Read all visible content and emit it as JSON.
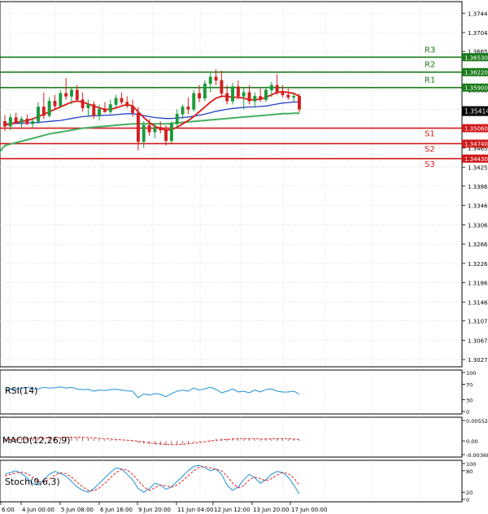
{
  "chart_data": {
    "type": "candlestick",
    "price_ticks": [
      "1.37440",
      "1.37040",
      "1.36650",
      "1.36250",
      "1.35850",
      "1.35450",
      "1.35060",
      "1.34650",
      "1.34250",
      "1.33860",
      "1.33460",
      "1.33060",
      "1.32660",
      "1.32260",
      "1.31860",
      "1.31460",
      "1.31070",
      "1.30670",
      "1.30270"
    ],
    "price_range": [
      1.3012,
      1.3768
    ],
    "levels": [
      {
        "name": "R3",
        "value": 1.3653,
        "tag": "1.36530",
        "color": "#1a7a1a"
      },
      {
        "name": "R2",
        "value": 1.3622,
        "tag": "1.36220",
        "color": "#1a7a1a"
      },
      {
        "name": "R1",
        "value": 1.359,
        "tag": "1.35900",
        "color": "#1a7a1a"
      },
      {
        "name": "S1",
        "value": 1.3506,
        "tag": "1.35060",
        "color": "#d11a1a"
      },
      {
        "name": "S2",
        "value": 1.3474,
        "tag": "1.34740",
        "color": "#d11a1a"
      },
      {
        "name": "S3",
        "value": 1.3443,
        "tag": "1.34430",
        "color": "#d11a1a"
      }
    ],
    "current_price": "1.35414",
    "current_price_value": 1.35414,
    "x_ticks": [
      "6:00",
      "4 Jun 00:00",
      "5 Jun 08:00",
      "6 Jun 16:00",
      "9 Jun 20:00",
      "11 Jun 04:00",
      "12 Jun 12:00",
      "13 Jun 20:00",
      "17 Jun 00:00"
    ],
    "candles": [
      {
        "o": 1.352,
        "h": 1.3533,
        "l": 1.35,
        "c": 1.351
      },
      {
        "o": 1.351,
        "h": 1.3535,
        "l": 1.3502,
        "c": 1.3528
      },
      {
        "o": 1.3528,
        "h": 1.3538,
        "l": 1.3515,
        "c": 1.3518
      },
      {
        "o": 1.3518,
        "h": 1.353,
        "l": 1.3508,
        "c": 1.3525
      },
      {
        "o": 1.3525,
        "h": 1.3534,
        "l": 1.3512,
        "c": 1.3515
      },
      {
        "o": 1.3515,
        "h": 1.3528,
        "l": 1.3507,
        "c": 1.352
      },
      {
        "o": 1.352,
        "h": 1.356,
        "l": 1.3515,
        "c": 1.355
      },
      {
        "o": 1.355,
        "h": 1.358,
        "l": 1.3525,
        "c": 1.3532
      },
      {
        "o": 1.3532,
        "h": 1.357,
        "l": 1.3528,
        "c": 1.3562
      },
      {
        "o": 1.3562,
        "h": 1.3575,
        "l": 1.3545,
        "c": 1.3552
      },
      {
        "o": 1.3552,
        "h": 1.3585,
        "l": 1.3548,
        "c": 1.3578
      },
      {
        "o": 1.3578,
        "h": 1.361,
        "l": 1.3565,
        "c": 1.3572
      },
      {
        "o": 1.3572,
        "h": 1.359,
        "l": 1.3555,
        "c": 1.3585
      },
      {
        "o": 1.3585,
        "h": 1.3595,
        "l": 1.356,
        "c": 1.3565
      },
      {
        "o": 1.3565,
        "h": 1.358,
        "l": 1.354,
        "c": 1.3548
      },
      {
        "o": 1.3548,
        "h": 1.3565,
        "l": 1.353,
        "c": 1.3555
      },
      {
        "o": 1.3555,
        "h": 1.3562,
        "l": 1.3525,
        "c": 1.3532
      },
      {
        "o": 1.3532,
        "h": 1.3555,
        "l": 1.3522,
        "c": 1.3545
      },
      {
        "o": 1.3545,
        "h": 1.356,
        "l": 1.3538,
        "c": 1.354
      },
      {
        "o": 1.354,
        "h": 1.3565,
        "l": 1.3535,
        "c": 1.3555
      },
      {
        "o": 1.3555,
        "h": 1.3575,
        "l": 1.3548,
        "c": 1.3568
      },
      {
        "o": 1.3568,
        "h": 1.358,
        "l": 1.3555,
        "c": 1.356
      },
      {
        "o": 1.356,
        "h": 1.3572,
        "l": 1.3548,
        "c": 1.3552
      },
      {
        "o": 1.3552,
        "h": 1.3565,
        "l": 1.353,
        "c": 1.3538
      },
      {
        "o": 1.3538,
        "h": 1.355,
        "l": 1.346,
        "c": 1.3478
      },
      {
        "o": 1.3478,
        "h": 1.352,
        "l": 1.3465,
        "c": 1.3512
      },
      {
        "o": 1.3512,
        "h": 1.3525,
        "l": 1.349,
        "c": 1.3498
      },
      {
        "o": 1.3498,
        "h": 1.3515,
        "l": 1.3485,
        "c": 1.3508
      },
      {
        "o": 1.3508,
        "h": 1.352,
        "l": 1.3495,
        "c": 1.3502
      },
      {
        "o": 1.3502,
        "h": 1.3512,
        "l": 1.347,
        "c": 1.348
      },
      {
        "o": 1.348,
        "h": 1.352,
        "l": 1.3475,
        "c": 1.3515
      },
      {
        "o": 1.3515,
        "h": 1.3545,
        "l": 1.3505,
        "c": 1.3535
      },
      {
        "o": 1.3535,
        "h": 1.3555,
        "l": 1.3525,
        "c": 1.355
      },
      {
        "o": 1.355,
        "h": 1.357,
        "l": 1.3535,
        "c": 1.3545
      },
      {
        "o": 1.3545,
        "h": 1.3585,
        "l": 1.354,
        "c": 1.3578
      },
      {
        "o": 1.3578,
        "h": 1.3595,
        "l": 1.356,
        "c": 1.3568
      },
      {
        "o": 1.3568,
        "h": 1.3605,
        "l": 1.3562,
        "c": 1.3598
      },
      {
        "o": 1.3598,
        "h": 1.362,
        "l": 1.358,
        "c": 1.3612
      },
      {
        "o": 1.3612,
        "h": 1.3628,
        "l": 1.3595,
        "c": 1.3605
      },
      {
        "o": 1.3605,
        "h": 1.3625,
        "l": 1.357,
        "c": 1.3578
      },
      {
        "o": 1.3578,
        "h": 1.3595,
        "l": 1.3555,
        "c": 1.3562
      },
      {
        "o": 1.3562,
        "h": 1.36,
        "l": 1.3555,
        "c": 1.3592
      },
      {
        "o": 1.3592,
        "h": 1.3605,
        "l": 1.3565,
        "c": 1.3572
      },
      {
        "o": 1.3572,
        "h": 1.359,
        "l": 1.3545,
        "c": 1.358
      },
      {
        "o": 1.358,
        "h": 1.3595,
        "l": 1.3555,
        "c": 1.3562
      },
      {
        "o": 1.3562,
        "h": 1.358,
        "l": 1.355,
        "c": 1.3572
      },
      {
        "o": 1.3572,
        "h": 1.3588,
        "l": 1.356,
        "c": 1.3565
      },
      {
        "o": 1.3565,
        "h": 1.3592,
        "l": 1.356,
        "c": 1.3585
      },
      {
        "o": 1.3585,
        "h": 1.3602,
        "l": 1.357,
        "c": 1.3595
      },
      {
        "o": 1.3595,
        "h": 1.3618,
        "l": 1.3575,
        "c": 1.358
      },
      {
        "o": 1.358,
        "h": 1.3595,
        "l": 1.357,
        "c": 1.3575
      },
      {
        "o": 1.3575,
        "h": 1.3588,
        "l": 1.3565,
        "c": 1.357
      },
      {
        "o": 1.357,
        "h": 1.358,
        "l": 1.356,
        "c": 1.3572
      },
      {
        "o": 1.3572,
        "h": 1.3578,
        "l": 1.3538,
        "c": 1.3545
      }
    ],
    "ma_red": [
      1.3512,
      1.3515,
      1.3518,
      1.352,
      1.3522,
      1.3525,
      1.353,
      1.3535,
      1.354,
      1.3545,
      1.355,
      1.3555,
      1.356,
      1.3562,
      1.356,
      1.3556,
      1.3552,
      1.3548,
      1.3545,
      1.3545,
      1.3548,
      1.3552,
      1.3555,
      1.3552,
      1.354,
      1.3528,
      1.3518,
      1.351,
      1.3505,
      1.3502,
      1.3503,
      1.3508,
      1.3515,
      1.3522,
      1.353,
      1.354,
      1.355,
      1.356,
      1.3568,
      1.3572,
      1.3572,
      1.357,
      1.357,
      1.3568,
      1.3565,
      1.3565,
      1.3566,
      1.357,
      1.3575,
      1.358,
      1.3582,
      1.358,
      1.3578,
      1.3572
    ],
    "ma_blue": [
      1.3515,
      1.3515,
      1.3516,
      1.3516,
      1.3517,
      1.3517,
      1.3518,
      1.3519,
      1.352,
      1.3521,
      1.3522,
      1.3524,
      1.3526,
      1.3528,
      1.353,
      1.3531,
      1.3532,
      1.3532,
      1.3533,
      1.3533,
      1.3534,
      1.3535,
      1.3536,
      1.3536,
      1.3534,
      1.3532,
      1.353,
      1.3528,
      1.3527,
      1.3526,
      1.3526,
      1.3527,
      1.3528,
      1.3529,
      1.3531,
      1.3533,
      1.3535,
      1.3538,
      1.3541,
      1.3543,
      1.3545,
      1.3547,
      1.3548,
      1.3549,
      1.355,
      1.355,
      1.3551,
      1.3552,
      1.3554,
      1.3556,
      1.3558,
      1.3559,
      1.356,
      1.356
    ],
    "ma_green": [
      1.347,
      1.3473,
      1.3476,
      1.3479,
      1.3482,
      1.3485,
      1.3488,
      1.3491,
      1.3494,
      1.3496,
      1.3498,
      1.35,
      1.3502,
      1.3504,
      1.3506,
      1.3507,
      1.3508,
      1.3509,
      1.351,
      1.3511,
      1.3512,
      1.3513,
      1.3514,
      1.3515,
      1.3515,
      1.3515,
      1.3515,
      1.3515,
      1.3515,
      1.3515,
      1.3516,
      1.3517,
      1.3518,
      1.3519,
      1.352,
      1.3521,
      1.3522,
      1.3523,
      1.3524,
      1.3525,
      1.3526,
      1.3527,
      1.3528,
      1.3529,
      1.353,
      1.3531,
      1.3532,
      1.3533,
      1.3534,
      1.3535,
      1.3536,
      1.3536,
      1.3537,
      1.3537
    ],
    "green_ma_extension": [
      {
        "price": 1.343
      },
      {
        "price": 1.344
      },
      {
        "price": 1.345
      },
      {
        "price": 1.3458
      },
      {
        "price": 1.3465
      }
    ],
    "rsi": {
      "label": "RSI(14)",
      "ticks": [
        "100",
        "70",
        "30",
        "0"
      ],
      "range": [
        0,
        100
      ],
      "values": [
        55,
        58,
        57,
        60,
        62,
        59,
        58,
        62,
        60,
        61,
        63,
        60,
        62,
        58,
        56,
        57,
        52,
        55,
        54,
        56,
        57,
        55,
        53,
        52,
        35,
        45,
        42,
        46,
        44,
        38,
        46,
        52,
        55,
        52,
        60,
        55,
        58,
        62,
        57,
        48,
        52,
        58,
        50,
        52,
        48,
        55,
        50,
        56,
        58,
        52,
        50,
        50,
        52,
        45
      ]
    },
    "macd": {
      "label": "MACD(12,26,9)",
      "ticks": [
        "0.005524",
        "0.00",
        "-0.003689"
      ],
      "range": [
        -0.003689,
        0.005524
      ],
      "hist": [
        0.0004,
        0.0005,
        0.0006,
        0.0006,
        0.0007,
        0.0008,
        0.0008,
        0.0009,
        0.0009,
        0.001,
        0.001,
        0.0011,
        0.0011,
        0.001,
        0.0009,
        0.0008,
        0.0006,
        0.0005,
        0.0004,
        0.0003,
        0.0002,
        0.0001,
        0.0,
        -0.0002,
        -0.0005,
        -0.0007,
        -0.0009,
        -0.001,
        -0.0011,
        -0.0012,
        -0.0011,
        -0.001,
        -0.0008,
        -0.0006,
        -0.0004,
        -0.0002,
        0.0,
        0.0003,
        0.0005,
        0.0006,
        0.0007,
        0.0007,
        0.0007,
        0.0006,
        0.0006,
        0.0005,
        0.0005,
        0.0006,
        0.0006,
        0.0006,
        0.0006,
        0.0005,
        0.0004,
        0.0003
      ],
      "signal": [
        0.0003,
        0.0004,
        0.0005,
        0.0005,
        0.0006,
        0.0007,
        0.0007,
        0.0008,
        0.0008,
        0.0009,
        0.0009,
        0.001,
        0.001,
        0.001,
        0.001,
        0.0009,
        0.0008,
        0.0007,
        0.0006,
        0.0005,
        0.0004,
        0.0003,
        0.0002,
        0.0001,
        -0.0001,
        -0.0003,
        -0.0005,
        -0.0007,
        -0.0008,
        -0.0009,
        -0.001,
        -0.001,
        -0.0009,
        -0.0008,
        -0.0006,
        -0.0004,
        -0.0002,
        0.0,
        0.0002,
        0.0003,
        0.0004,
        0.0005,
        0.0006,
        0.0006,
        0.0006,
        0.0006,
        0.0005,
        0.0005,
        0.0006,
        0.0006,
        0.0006,
        0.0006,
        0.0005,
        0.0004
      ]
    },
    "stoch": {
      "label": "Stoch(9,6,3)",
      "ticks": [
        "100",
        "80",
        "20",
        "0"
      ],
      "range": [
        0,
        100
      ],
      "k": [
        70,
        75,
        80,
        72,
        60,
        45,
        40,
        55,
        70,
        78,
        72,
        65,
        50,
        35,
        25,
        20,
        30,
        45,
        60,
        75,
        88,
        85,
        70,
        55,
        30,
        20,
        30,
        45,
        40,
        28,
        35,
        50,
        65,
        80,
        92,
        95,
        88,
        80,
        85,
        70,
        40,
        25,
        35,
        55,
        70,
        60,
        45,
        55,
        70,
        78,
        75,
        62,
        40,
        15
      ],
      "d": [
        65,
        70,
        74,
        76,
        72,
        62,
        50,
        48,
        56,
        68,
        74,
        72,
        62,
        48,
        35,
        25,
        24,
        32,
        45,
        60,
        75,
        84,
        82,
        70,
        52,
        35,
        25,
        32,
        40,
        38,
        34,
        40,
        52,
        66,
        80,
        90,
        92,
        88,
        84,
        80,
        65,
        45,
        32,
        38,
        55,
        62,
        58,
        52,
        58,
        68,
        75,
        72,
        60,
        40
      ]
    },
    "colors": {
      "bull": "#1a9a3a",
      "bear": "#d22020",
      "ma_red": "#e01414",
      "ma_blue": "#2040c8",
      "ma_green": "#44b060",
      "level_green": "#1a7a1a",
      "level_red": "#d11a1a",
      "oscillator": "#1e90d8",
      "signal": "#e02020"
    }
  }
}
